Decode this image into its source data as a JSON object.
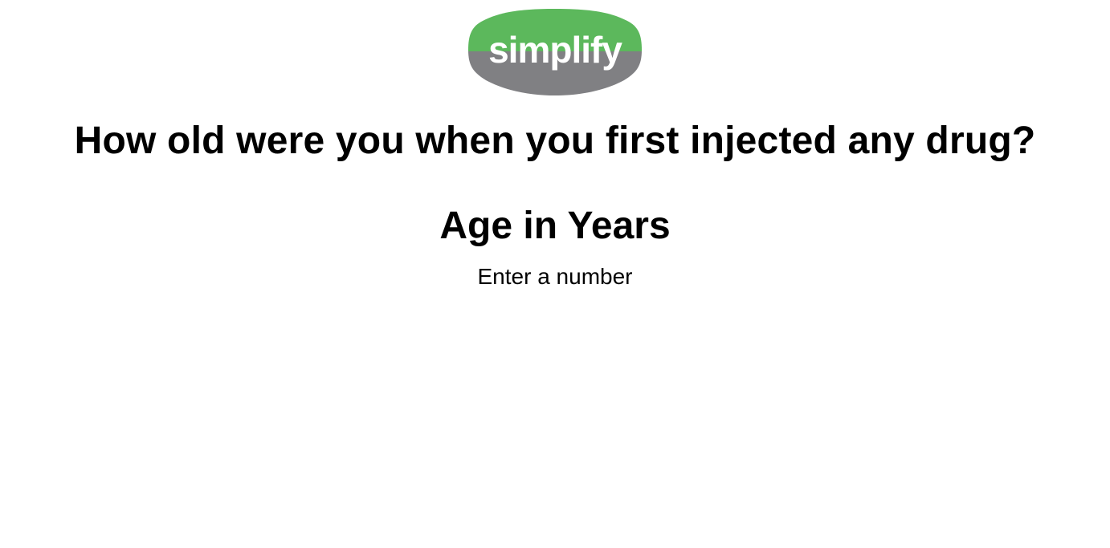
{
  "logo": {
    "text": "simplify",
    "colors": {
      "top": "#5cb85c",
      "bottom": "#808083",
      "text": "#ffffff"
    }
  },
  "question": {
    "text": "How old were you when you first injected any drug?"
  },
  "answer": {
    "unit_label": "Age in Years",
    "value": "",
    "placeholder": "Enter a number"
  }
}
